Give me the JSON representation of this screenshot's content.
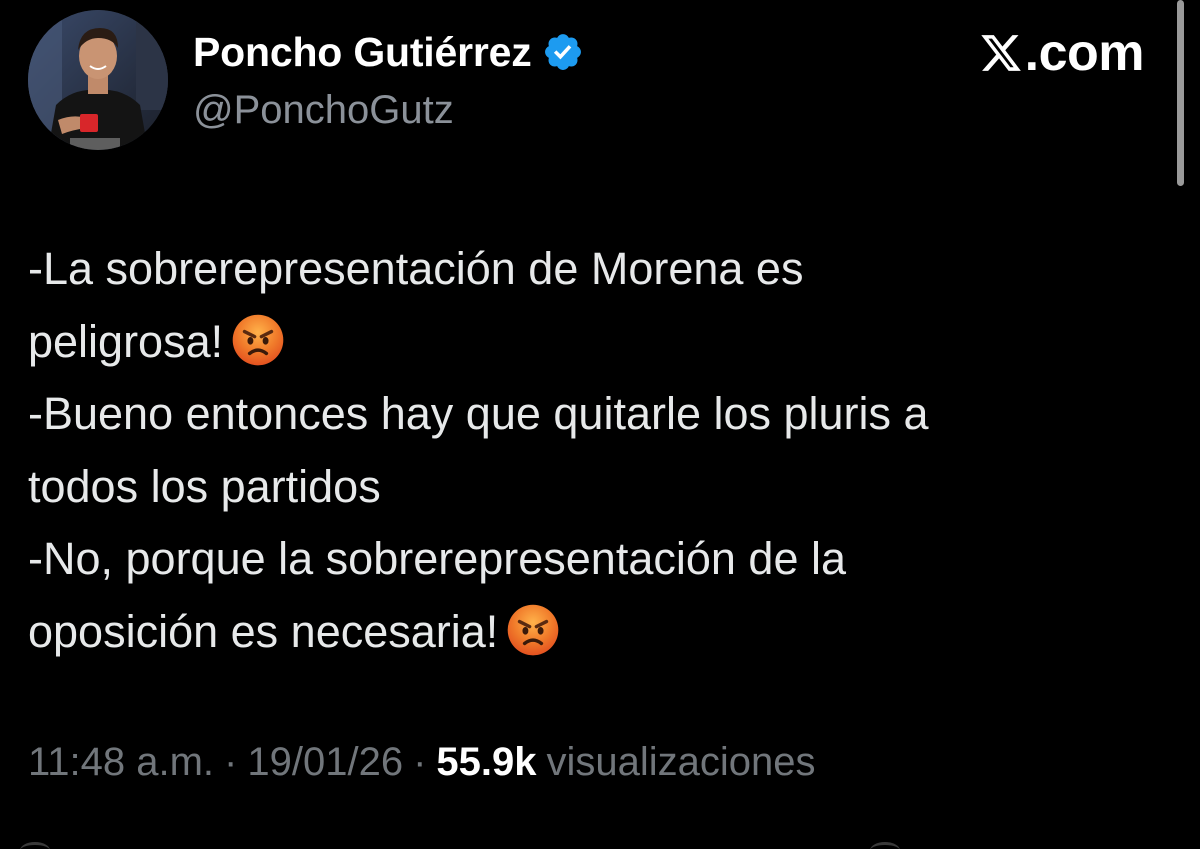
{
  "author": {
    "display_name": "Poncho Gutiérrez",
    "handle": "@PonchoGutz",
    "verified": true,
    "verified_color": "#1d9bf0"
  },
  "brand": {
    "icon": "x-logo-icon",
    "label": ".com"
  },
  "tweet": {
    "lines": [
      "-La sobrerepresentación de Morena es",
      "peligrosa!",
      "-Bueno entonces hay que quitarle los pluris a",
      "todos los partidos",
      "-No, porque la sobrerepresentación de la",
      "oposición es necesaria!"
    ],
    "emoji": "angry-face-emoji"
  },
  "meta": {
    "time": "11:48 a.m.",
    "separator": "·",
    "date": "19/01/26",
    "views_count": "55.9k",
    "views_label": "visualizaciones"
  },
  "colors": {
    "background": "#000000",
    "text": "#e7e9ea",
    "secondary": "#71767b",
    "accent": "#1d9bf0"
  }
}
